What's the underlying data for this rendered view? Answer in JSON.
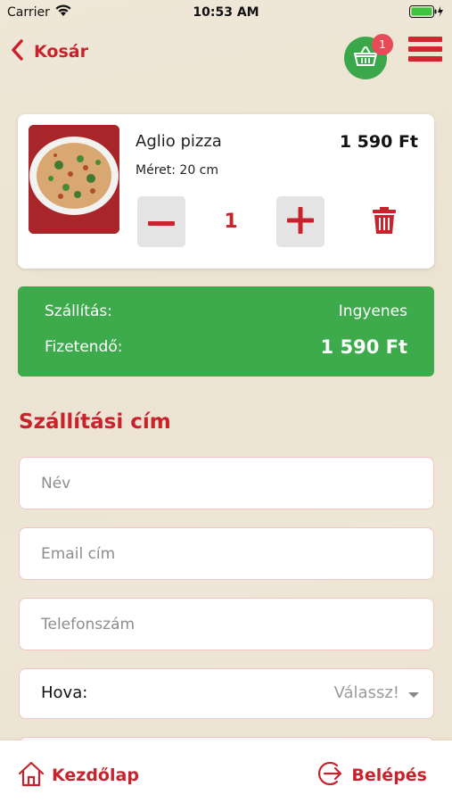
{
  "status_bar": {
    "carrier": "Carrier",
    "time": "10:53 AM"
  },
  "nav": {
    "back_label": "Kosár",
    "cart_count": "1"
  },
  "cart_item": {
    "name": "Aglio pizza",
    "price": "1 590 Ft",
    "size": "Méret: 20 cm",
    "quantity": "1"
  },
  "summary": {
    "shipping_label": "Szállítás:",
    "shipping_value": "Ingyenes",
    "total_label": "Fizetendő:",
    "total_value": "1 590 Ft"
  },
  "address": {
    "title": "Szállítási cím",
    "name_placeholder": "Név",
    "email_placeholder": "Email cím",
    "phone_placeholder": "Telefonszám",
    "destination_label": "Hova:",
    "destination_value": "Válassz!"
  },
  "tabbar": {
    "home_label": "Kezdőlap",
    "login_label": "Belépés"
  },
  "colors": {
    "brand_red": "#c8232d",
    "green": "#3daa4b",
    "badge": "#e74b57"
  }
}
